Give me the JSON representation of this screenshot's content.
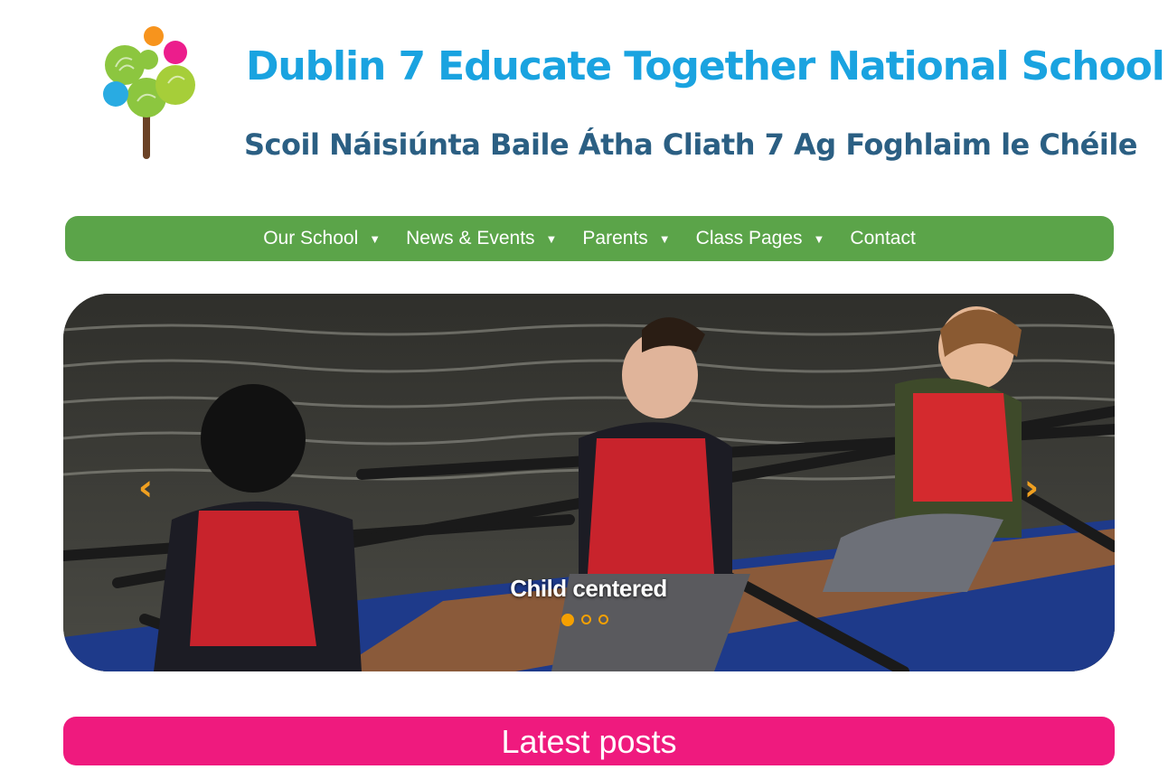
{
  "header": {
    "title": "Dublin 7 Educate Together National School",
    "subtitle": "Scoil Náisiúnta Baile Átha Cliath 7 Ag Foghlaim le Chéile",
    "logo_icon": "tree-handprints-icon"
  },
  "nav": {
    "items": [
      {
        "label": "Our School",
        "has_dropdown": true
      },
      {
        "label": "News & Events",
        "has_dropdown": true
      },
      {
        "label": "Parents",
        "has_dropdown": true
      },
      {
        "label": "Class Pages",
        "has_dropdown": true
      },
      {
        "label": "Contact",
        "has_dropdown": false
      }
    ],
    "caret": "▼"
  },
  "slider": {
    "caption": "Child centered",
    "prev_glyph": "‹",
    "next_glyph": "›",
    "active_slide": 1,
    "slide_count": 3
  },
  "sections": {
    "latest_posts": "Latest posts"
  },
  "colors": {
    "title": "#1aa3e0",
    "subtitle": "#2b5f83",
    "nav_bg": "#5ba449",
    "accent_orange": "#f5a000",
    "latest_posts_bg": "#ef1a7e"
  }
}
